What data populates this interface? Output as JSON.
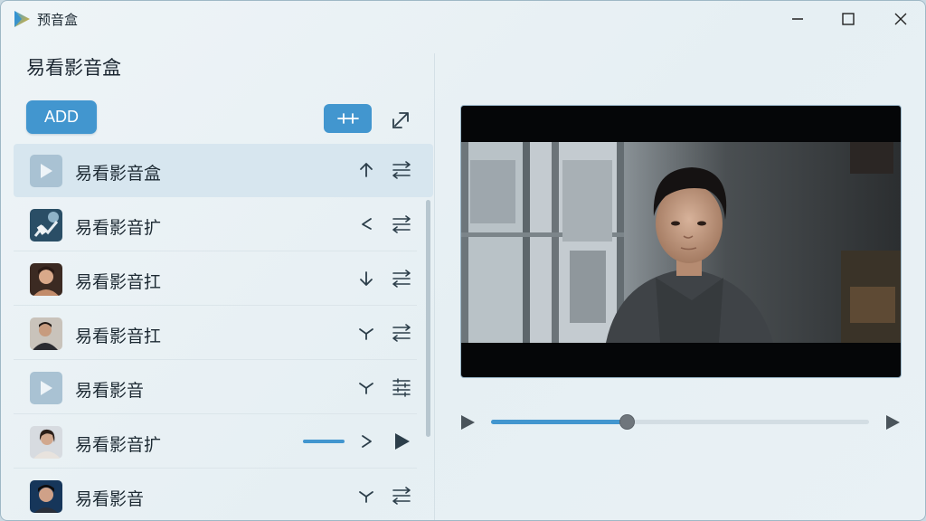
{
  "window": {
    "title": "预音盒",
    "controls": [
      "minimize-icon",
      "maximize-icon",
      "close-icon"
    ]
  },
  "colors": {
    "accent": "#4296cf",
    "background": "#eaf2f6",
    "text": "#1d2a33"
  },
  "left_panel": {
    "title": "易看影音盒",
    "add_button": {
      "label": "ADD"
    },
    "merge_button": {
      "icon": "merge-icon"
    },
    "expand_button": {
      "icon": "expand-arrow-icon"
    },
    "items": [
      {
        "label": "易看影音盒",
        "thumb": "play-placeholder",
        "action_icon": "arrow-up-icon",
        "menu_icon": "reorder-icon",
        "selected": true
      },
      {
        "label": "易看影音扩",
        "thumb": "image-thumbnail",
        "action_icon": "chevron-left-icon",
        "menu_icon": "reorder-icon",
        "selected": false
      },
      {
        "label": "易看影音扛",
        "thumb": "portrait-thumbnail",
        "action_icon": "arrow-down-icon",
        "menu_icon": "reorder-icon",
        "selected": false
      },
      {
        "label": "易看影音扛",
        "thumb": "portrait-thumbnail",
        "action_icon": "chevron-down-icon",
        "menu_icon": "reorder-icon",
        "selected": false
      },
      {
        "label": "易看影音",
        "thumb": "play-placeholder",
        "action_icon": "chevron-down-icon",
        "menu_icon": "list-icon",
        "selected": false
      },
      {
        "label": "易看影音扩",
        "thumb": "portrait-thumbnail",
        "action_icon": "chevron-right-icon",
        "menu_icon": "play-icon",
        "selected": false,
        "progress": 0.9
      },
      {
        "label": "易看影音",
        "thumb": "portrait-thumbnail",
        "action_icon": "chevron-down-icon",
        "menu_icon": "reorder-icon",
        "selected": false
      }
    ]
  },
  "player": {
    "scene": "young man in hoodie sitting by window",
    "progress": 0.36,
    "play_icon": "play-icon",
    "next_icon": "play-icon"
  }
}
